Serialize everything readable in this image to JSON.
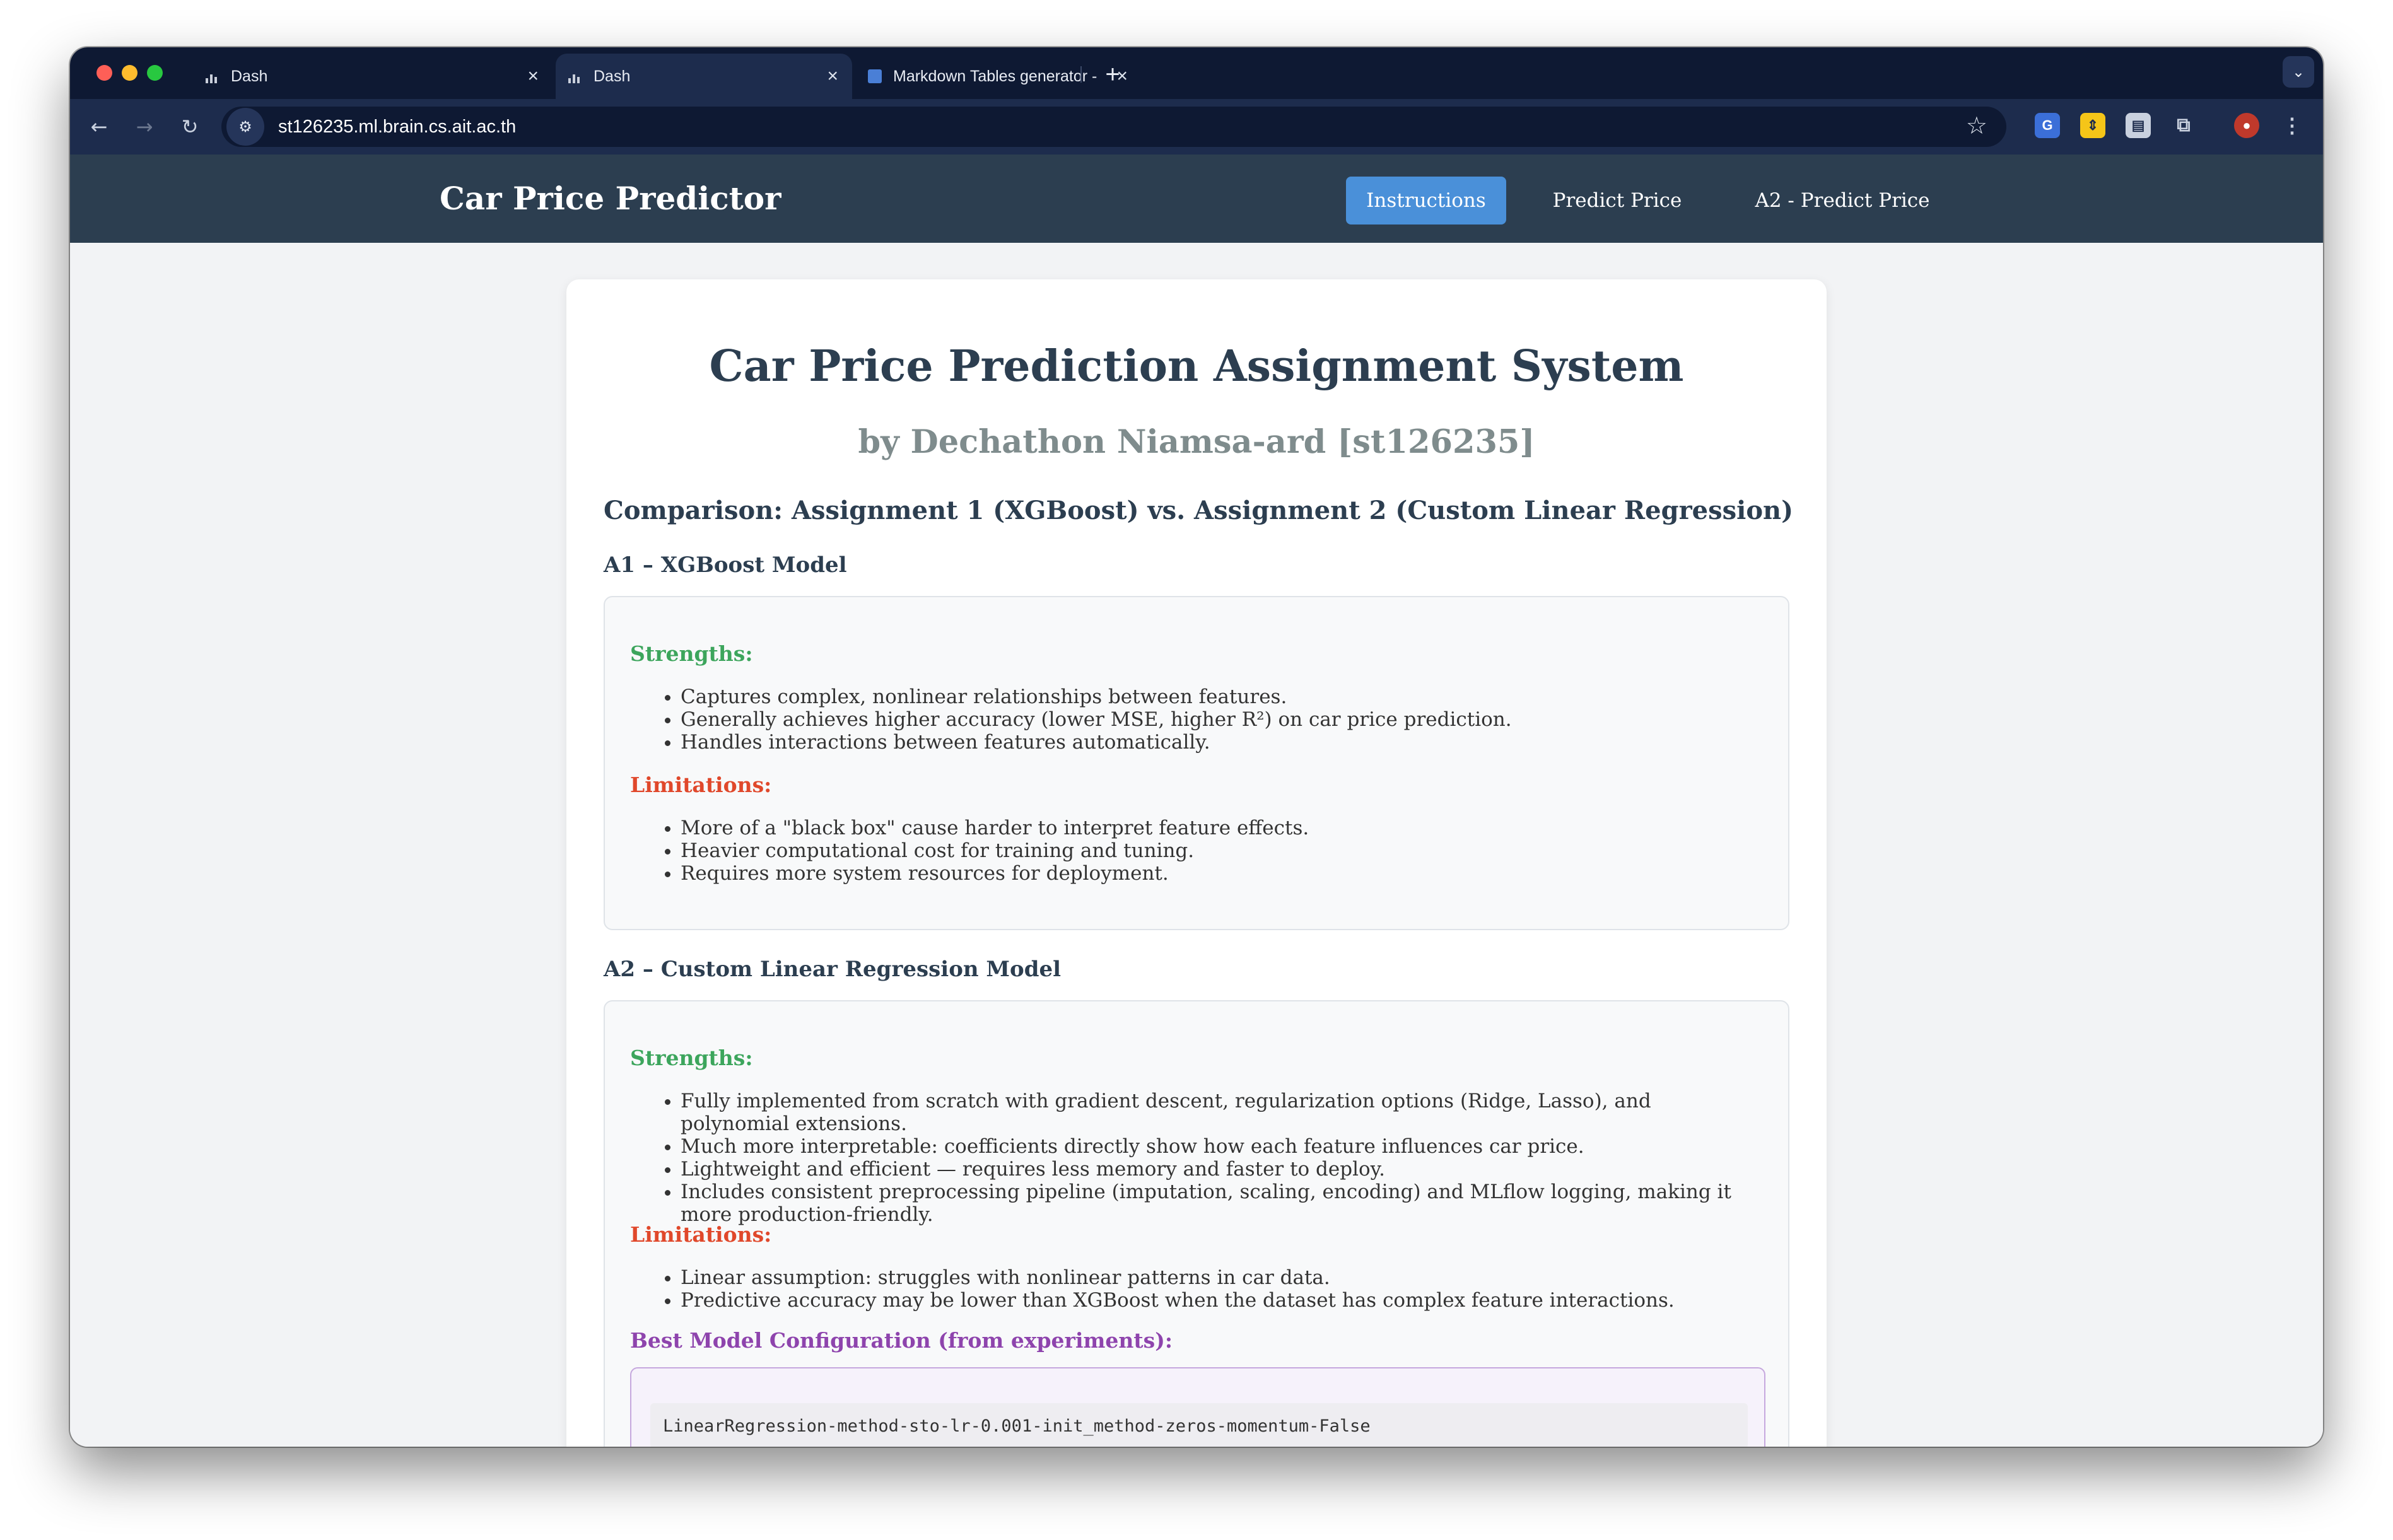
{
  "browser": {
    "tabs": [
      {
        "title": "Dash",
        "active": false
      },
      {
        "title": "Dash",
        "active": true
      },
      {
        "title": "Markdown Tables generator -",
        "active": false
      }
    ],
    "url": "st126235.ml.brain.cs.ait.ac.th"
  },
  "nav": {
    "brand": "Car Price Predictor",
    "links": [
      "Instructions",
      "Predict Price",
      "A2 - Predict Price"
    ],
    "active": "Instructions"
  },
  "page": {
    "title": "Car Price Prediction Assignment System",
    "subtitle": "by Dechathon Niamsa-ard [st126235]",
    "comparison_heading": "Comparison: Assignment 1 (XGBoost) vs. Assignment 2 (Custom Linear Regression)",
    "a1": {
      "heading": "A1 – XGBoost Model",
      "strengths_label": "Strengths:",
      "strengths": [
        "Captures complex, nonlinear relationships between features.",
        "Generally achieves higher accuracy (lower MSE, higher R²) on car price prediction.",
        "Handles interactions between features automatically."
      ],
      "limitations_label": "Limitations:",
      "limitations": [
        "More of a \"black box\" cause harder to interpret feature effects.",
        "Heavier computational cost for training and tuning.",
        "Requires more system resources for deployment."
      ]
    },
    "a2": {
      "heading": "A2 – Custom Linear Regression Model",
      "strengths_label": "Strengths:",
      "strengths": [
        "Fully implemented from scratch with gradient descent, regularization options (Ridge, Lasso), and polynomial extensions.",
        "Much more interpretable: coefficients directly show how each feature influences car price.",
        "Lightweight and efficient — requires less memory and faster to deploy.",
        "Includes consistent preprocessing pipeline (imputation, scaling, encoding) and MLflow logging, making it more production-friendly."
      ],
      "limitations_label": "Limitations:",
      "limitations": [
        "Linear assumption: struggles with nonlinear patterns in car data.",
        "Predictive accuracy may be lower than XGBoost when the dataset has complex feature interactions."
      ],
      "best_label": "Best Model Configuration (from experiments):",
      "best_config": "LinearRegression-method-sto-lr-0.001-init_method-zeros-momentum-False"
    }
  }
}
